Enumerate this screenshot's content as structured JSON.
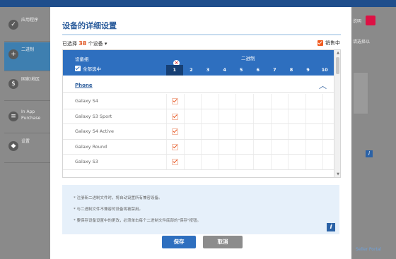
{
  "background": {
    "sidebar_items": [
      {
        "label": "应用程序",
        "icon": "check-icon"
      },
      {
        "label": "二进制",
        "icon": "plus-icon"
      },
      {
        "label": "国家/地区",
        "icon": "dollar-icon"
      },
      {
        "label": "In App Purchase",
        "icon": "list-icon"
      },
      {
        "label": "设置",
        "icon": "shield-icon"
      }
    ],
    "right_label_1": "说明",
    "right_label_2": "请选择以",
    "link": "Seller Portal"
  },
  "modal": {
    "title": "设备的详细设置",
    "count_prefix": "已选择",
    "count_value": "38",
    "count_suffix": "个设备",
    "sale_label": "销售中",
    "table": {
      "device_group_header": "设备组",
      "select_all_label": "全部选中",
      "binary_header": "二进制",
      "binary_columns": [
        "1",
        "2",
        "3",
        "4",
        "5",
        "6",
        "7",
        "8",
        "9",
        "10"
      ],
      "selected_binary": "1",
      "group_name": "Phone",
      "devices": [
        {
          "name": "Galaxy S4",
          "checked_binary": "1"
        },
        {
          "name": "Galaxy S3 Sport",
          "checked_binary": "1"
        },
        {
          "name": "Galaxy S4 Active",
          "checked_binary": "1"
        },
        {
          "name": "Galaxy Round",
          "checked_binary": "1"
        },
        {
          "name": "Galaxy S3",
          "checked_binary": "1"
        }
      ]
    },
    "notes": [
      "* 注册新二进制文件时，将自动设置所有兼容设备。",
      "* 与二进制文件不兼容的设备将被禁用。",
      "* 要保存设备设置中的更改，必须单击每个二进制文件底部的\"保存\"按钮。"
    ],
    "save_button": "保存",
    "cancel_button": "取消"
  }
}
